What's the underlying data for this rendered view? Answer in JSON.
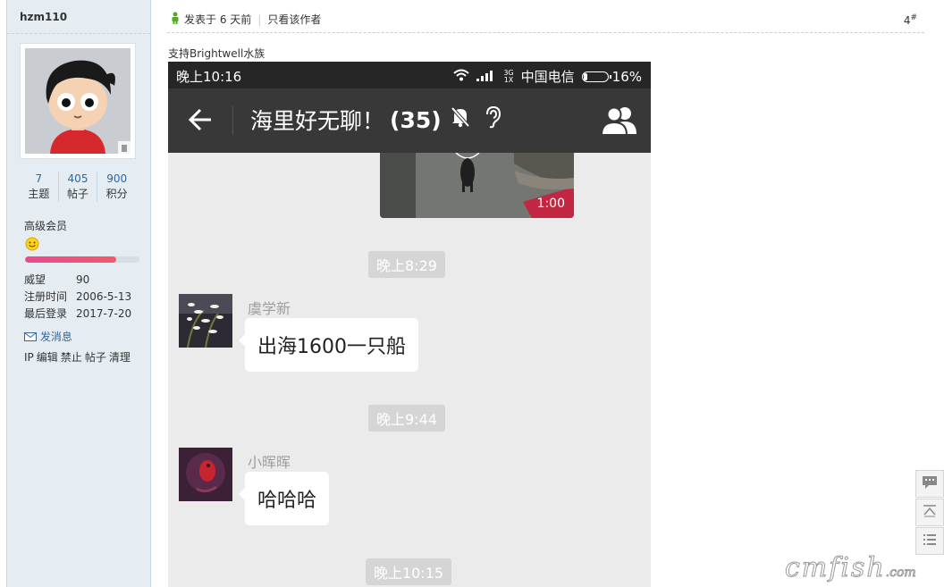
{
  "user": {
    "name": "hzm110",
    "stats": [
      {
        "value": "7",
        "label": "主题"
      },
      {
        "value": "405",
        "label": "帖子"
      },
      {
        "value": "900",
        "label": "积分"
      }
    ],
    "rank": "高级会员",
    "rank_progress": 0.8,
    "info": [
      {
        "key": "威望",
        "value": "90"
      },
      {
        "key": "注册时间",
        "value": "2006-5-13"
      },
      {
        "key": "最后登录",
        "value": "2017-7-20"
      }
    ],
    "send_message": "发消息",
    "admin_links": [
      "IP",
      "编辑",
      "禁止",
      "帖子",
      "清理"
    ]
  },
  "post": {
    "posted": "发表于 6 天前",
    "only_author": "只看该作者",
    "floor": "4",
    "floor_mark": "#",
    "text": "支持Brightwell水族"
  },
  "phone": {
    "status": {
      "time": "晚上10:16",
      "net_small_top": "3G",
      "net_small_bottom": "1X",
      "carrier": "中国电信",
      "battery": "16%",
      "battery_level": 0.16
    },
    "title": "海里好无聊！",
    "member_count": "(35)",
    "video_duration": "1:00",
    "messages": [
      {
        "time": "晚上8:29",
        "sender": "虞学新",
        "text": "出海1600一只船"
      },
      {
        "time": "晚上9:44",
        "sender": "小晖晖",
        "text": "哈哈哈"
      },
      {
        "time": "晚上10:15"
      }
    ]
  },
  "watermark": {
    "main": "cmfish",
    "tail": ".com"
  },
  "colors": {
    "sidebar_bg": "#e5edf2",
    "link": "#336699",
    "chat_bg": "#ebebeb",
    "nav_bg": "#383838"
  }
}
